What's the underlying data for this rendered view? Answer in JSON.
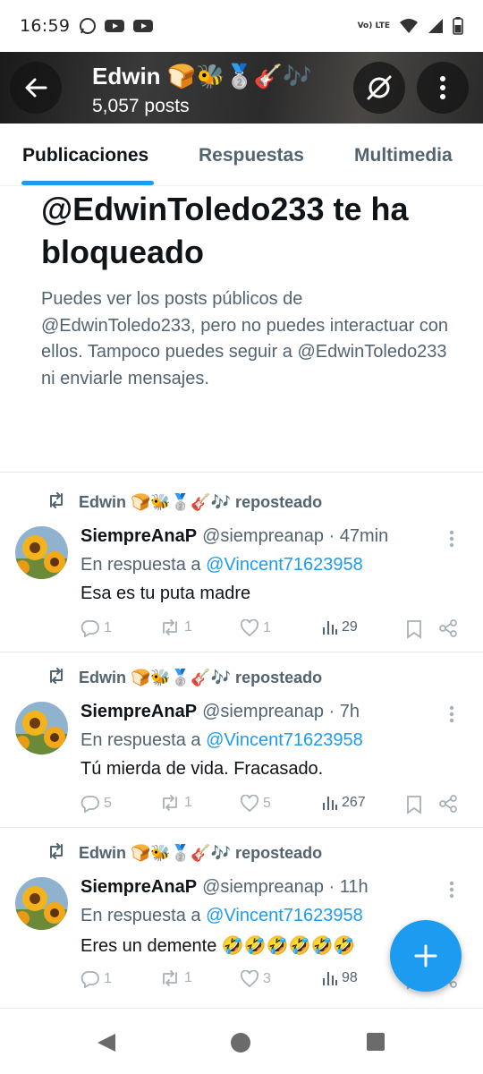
{
  "status_bar": {
    "time": "16:59",
    "network_label": "Vo) LTE",
    "icons": [
      "whatsapp-icon",
      "youtube-icon",
      "youtube-icon",
      "volte-icon",
      "wifi-icon",
      "signal-icon",
      "battery-icon"
    ]
  },
  "header": {
    "name": "Edwin 🍞🐝🥈🎸🎶",
    "posts_count": "5,057 posts",
    "icons": [
      "back-arrow-icon",
      "grok-icon",
      "more-vertical-icon"
    ]
  },
  "tabs": [
    {
      "label": "Publicaciones",
      "active": true
    },
    {
      "label": "Respuestas",
      "active": false
    },
    {
      "label": "Multimedia",
      "active": false
    }
  ],
  "blocked": {
    "title": "@EdwinToledo233 te ha bloqueado",
    "description": "Puedes ver los posts públicos de @EdwinToledo233, pero no puedes interactuar con ellos. Tampoco puedes seguir a @EdwinToledo233 ni enviarle mensajes."
  },
  "posts": [
    {
      "repost_label": "Edwin 🍞🐝🥈🎸🎶 reposteado",
      "author": "SiempreAnaP",
      "handle_time": "@siempreanap · 47min",
      "reply_prefix": "En respuesta a",
      "reply_to": "@Vincent71623958",
      "text": "Esa es tu puta madre",
      "replies": "1",
      "reposts": "1",
      "likes": "1",
      "views": "29"
    },
    {
      "repost_label": "Edwin 🍞🐝🥈🎸🎶 reposteado",
      "author": "SiempreAnaP",
      "handle_time": "@siempreanap · 7h",
      "reply_prefix": "En respuesta a",
      "reply_to": "@Vincent71623958",
      "text": "Tú mierda de vida. Fracasado.",
      "replies": "5",
      "reposts": "1",
      "likes": "5",
      "views": "267"
    },
    {
      "repost_label": "Edwin 🍞🐝🥈🎸🎶 reposteado",
      "author": "SiempreAnaP",
      "handle_time": "@siempreanap · 11h",
      "reply_prefix": "En respuesta a",
      "reply_to": "@Vincent71623958",
      "text": "Eres un demente 🤣🤣🤣🤣🤣🤣",
      "replies": "1",
      "reposts": "1",
      "likes": "3",
      "views": "98"
    }
  ],
  "colors": {
    "accent": "#1d9bf0",
    "text_primary": "#0f1419",
    "text_secondary": "#536471"
  },
  "nav": {
    "icons": [
      "back-triangle-icon",
      "home-circle-icon",
      "recents-square-icon"
    ]
  }
}
